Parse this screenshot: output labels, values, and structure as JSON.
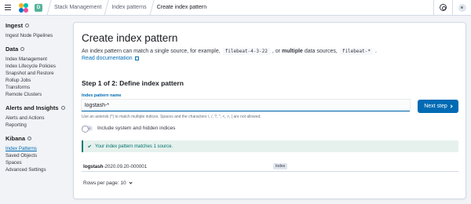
{
  "header": {
    "space_initial": "D",
    "user_initials": "e",
    "breadcrumbs": [
      "Stack Management",
      "Index patterns",
      "Create index pattern"
    ]
  },
  "sidebar": {
    "groups": [
      {
        "title": "Ingest",
        "has_help": true,
        "items": [
          {
            "label": "Ingest Node Pipelines"
          }
        ]
      },
      {
        "title": "Data",
        "has_help": true,
        "items": [
          {
            "label": "Index Management"
          },
          {
            "label": "Index Lifecycle Policies"
          },
          {
            "label": "Snapshot and Restore"
          },
          {
            "label": "Rollup Jobs"
          },
          {
            "label": "Transforms"
          },
          {
            "label": "Remote Clusters"
          }
        ]
      },
      {
        "title": "Alerts and Insights",
        "has_help": true,
        "items": [
          {
            "label": "Alerts and Actions"
          },
          {
            "label": "Reporting"
          }
        ]
      },
      {
        "title": "Kibana",
        "has_help": true,
        "items": [
          {
            "label": "Index Patterns",
            "active": true
          },
          {
            "label": "Saved Objects"
          },
          {
            "label": "Spaces"
          },
          {
            "label": "Advanced Settings"
          }
        ]
      }
    ]
  },
  "main": {
    "title": "Create index pattern",
    "desc_prefix": "An index pattern can match a single source, for example,",
    "example_single": "filebeat-4-3-22",
    "desc_or": ", or",
    "desc_multiple": "multiple",
    "desc_sources": "data sources,",
    "example_multi": "filebeat-*",
    "desc_end": ".",
    "read_docs": "Read documentation",
    "step_title": "Step 1 of 2: Define index pattern",
    "field_label": "Index pattern name",
    "field_value": "logstash-*",
    "field_help": "Use an asterisk (*) to match multiple indices. Spaces and the characters \\, /, ?, \", <, >, | are not allowed.",
    "next_label": "Next step",
    "toggle_label": "Include system and hidden indices",
    "callout_text": "Your index pattern matches 1 source.",
    "result": {
      "name_bold": "logstash",
      "name_rest": "-2020.09.20-000001",
      "badge": "Index"
    },
    "rows_per_page": "Rows per page: 10"
  },
  "colors": {
    "primary": "#006bb4",
    "success": "#017d73",
    "success_bg": "#e6f1ed"
  }
}
